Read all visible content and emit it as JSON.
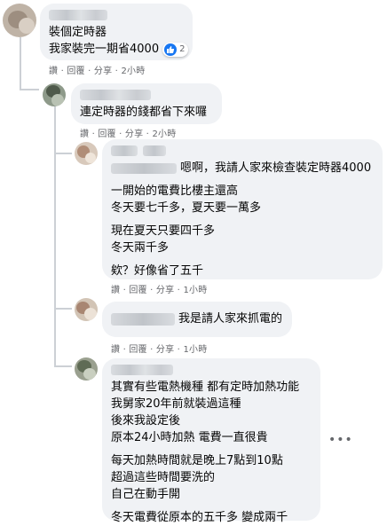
{
  "comments": [
    {
      "lines": [
        "裝個定時器",
        "我家裝完一期省4000"
      ],
      "reaction_count": "2",
      "meta": {
        "like": "讚",
        "reply": "回覆",
        "share": "分享",
        "time": "2小時"
      }
    },
    {
      "lines": [
        "連定時器的錢都省下來囉"
      ],
      "meta": {
        "like": "讚",
        "reply": "回覆",
        "share": "分享",
        "time": "2小時"
      }
    },
    {
      "first_line": "嗯啊，我請人家來檢查裝定時器4000",
      "lines_a": [
        "一開始的電費比樓主還高",
        "冬天要七千多，夏天要一萬多"
      ],
      "lines_b": [
        "現在夏天只要四千多",
        "冬天兩千多"
      ],
      "lines_c": [
        "欸？好像省了五千"
      ],
      "meta": {
        "like": "讚",
        "reply": "回覆",
        "share": "分享",
        "time": "1小時"
      }
    },
    {
      "first_line": "我是請人家來抓電的",
      "meta": {
        "like": "讚",
        "reply": "回覆",
        "share": "分享",
        "time": "1小時"
      }
    },
    {
      "lines_a": [
        "其實有些電熱機種 都有定時加熱功能",
        "我舅家20年前就裝過這種",
        "後來我設定後",
        "原本24小時加熱 電費一直很貴"
      ],
      "lines_b": [
        "每天加熱時間就是晚上7點到10點",
        "超過這些時間要洗的",
        "自己在動手開"
      ],
      "lines_c": [
        "冬天電費從原本的五千多 變成兩千"
      ]
    }
  ],
  "more_button": "•••",
  "sep": " · "
}
